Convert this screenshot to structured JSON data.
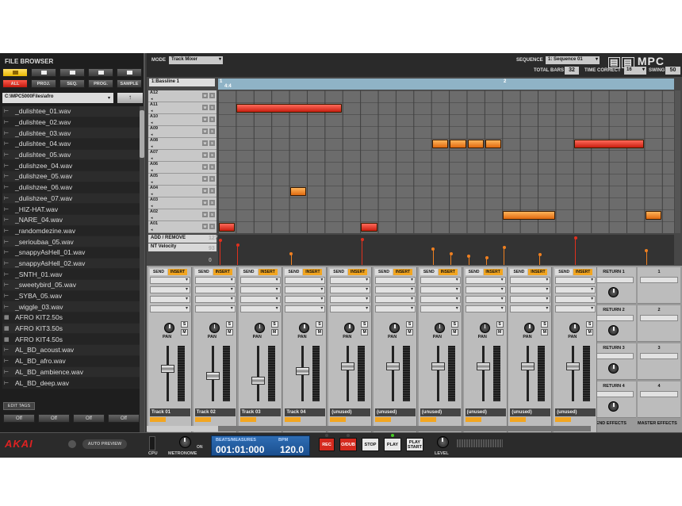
{
  "file_browser": {
    "title": "FILE BROWSER",
    "top_buttons": [
      "",
      "",
      "",
      "",
      ""
    ],
    "type_buttons": [
      "ALL",
      "PROJ.",
      "SEQ.",
      "PROG.",
      "SAMPLE"
    ],
    "path": "C:\\MPC5000Files\\afro",
    "up_label": "↑",
    "files": [
      {
        "name": "_dulishtee_01.wav",
        "icon": "audio"
      },
      {
        "name": "_dulishtee_02.wav",
        "icon": "audio"
      },
      {
        "name": "_dulishtee_03.wav",
        "icon": "audio"
      },
      {
        "name": "_dulishtee_04.wav",
        "icon": "audio"
      },
      {
        "name": "_dulishtee_05.wav",
        "icon": "audio"
      },
      {
        "name": "_dulishzee_04.wav",
        "icon": "audio"
      },
      {
        "name": "_dulishzee_05.wav",
        "icon": "audio"
      },
      {
        "name": "_dulishzee_06.wav",
        "icon": "audio"
      },
      {
        "name": "_dulishzee_07.wav",
        "icon": "audio"
      },
      {
        "name": "_HIZ-HAT.wav",
        "icon": "audio"
      },
      {
        "name": "_NARE_04.wav",
        "icon": "audio"
      },
      {
        "name": "_randomdezine.wav",
        "icon": "audio"
      },
      {
        "name": "_serioubaa_05.wav",
        "icon": "audio"
      },
      {
        "name": "_snappyAsHell_01.wav",
        "icon": "audio"
      },
      {
        "name": "_snappyAsHell_02.wav",
        "icon": "audio"
      },
      {
        "name": "_SNTH_01.wav",
        "icon": "audio"
      },
      {
        "name": "_sweetybird_05.wav",
        "icon": "audio"
      },
      {
        "name": "_SYBA_05.wav",
        "icon": "audio"
      },
      {
        "name": "_wiggle_03.wav",
        "icon": "audio"
      },
      {
        "name": "AFRO KIT2.50s",
        "icon": "kit"
      },
      {
        "name": "AFRO KIT3.50s",
        "icon": "kit"
      },
      {
        "name": "AFRO KIT4.50s",
        "icon": "kit"
      },
      {
        "name": "AL_BD_acoust.wav",
        "icon": "audio"
      },
      {
        "name": "AL_BD_afro.wav",
        "icon": "audio"
      },
      {
        "name": "AL_BD_ambience.wav",
        "icon": "audio"
      },
      {
        "name": "AL_BD_deep.wav",
        "icon": "audio"
      }
    ],
    "edit_tags": "EDIT TAGS",
    "off_buttons": [
      "Off",
      "Off",
      "Off",
      "Off"
    ]
  },
  "topbar": {
    "mode_label": "MODE",
    "mode_value": "Track Mixer",
    "sequence_label": "SEQUENCE",
    "sequence_value": "1: Sequence 01",
    "logo": "MPC",
    "total_bars_label": "TOTAL BARS",
    "total_bars": "32",
    "time_correct_label": "TIME CORRECT",
    "time_correct": "16",
    "swing_label": "SWING",
    "swing": "50"
  },
  "sequencer": {
    "track": "1:Bassline 1",
    "ruler_marks": [
      "1",
      "2"
    ],
    "ruler_sub": "4:4",
    "pads": [
      "A12",
      "A11",
      "A10",
      "A09",
      "A08",
      "A07",
      "A06",
      "A05",
      "A04",
      "A03",
      "A02",
      "A01"
    ],
    "pad_buttons": [
      "M",
      "S"
    ],
    "add_remove": "ADD / REMOVE",
    "velocity_label": "NT Velocity",
    "velocity_scale": [
      "127",
      "93",
      "0"
    ],
    "notes": [
      {
        "row": 1,
        "start": 1,
        "length": 6,
        "color": "red"
      },
      {
        "row": 4,
        "start": 12,
        "length": 1,
        "color": "orange"
      },
      {
        "row": 4,
        "start": 13,
        "length": 1,
        "color": "orange"
      },
      {
        "row": 4,
        "start": 14,
        "length": 1,
        "color": "orange"
      },
      {
        "row": 4,
        "start": 15,
        "length": 1,
        "color": "orange"
      },
      {
        "row": 4,
        "start": 20,
        "length": 4,
        "color": "red"
      },
      {
        "row": 8,
        "start": 4,
        "length": 1,
        "color": "orange"
      },
      {
        "row": 10,
        "start": 16,
        "length": 3,
        "color": "orange"
      },
      {
        "row": 10,
        "start": 24,
        "length": 1,
        "color": "orange"
      },
      {
        "row": 11,
        "start": 0,
        "length": 1,
        "color": "red"
      },
      {
        "row": 11,
        "start": 8,
        "length": 1,
        "color": "red"
      }
    ],
    "velocities": [
      {
        "step": 0,
        "value": 0.85,
        "color": "red"
      },
      {
        "step": 1,
        "value": 0.7,
        "color": "red"
      },
      {
        "step": 4,
        "value": 0.4,
        "color": "orange"
      },
      {
        "step": 8,
        "value": 0.9,
        "color": "red"
      },
      {
        "step": 12,
        "value": 0.55,
        "color": "orange"
      },
      {
        "step": 13,
        "value": 0.4,
        "color": "orange"
      },
      {
        "step": 14,
        "value": 0.3,
        "color": "orange"
      },
      {
        "step": 15,
        "value": 0.25,
        "color": "orange"
      },
      {
        "step": 16,
        "value": 0.6,
        "color": "orange"
      },
      {
        "step": 18,
        "value": 0.35,
        "color": "orange"
      },
      {
        "step": 20,
        "value": 0.95,
        "color": "red"
      },
      {
        "step": 24,
        "value": 0.5,
        "color": "orange"
      }
    ],
    "colors": {
      "red": "#e0301e",
      "orange": "#f08020"
    }
  },
  "mixer": {
    "send_label": "SEND",
    "insert_label": "INSERT",
    "pan_label": "PAN",
    "solo_label": "S",
    "mute_label": "M",
    "tracks": [
      {
        "name": "Track 01",
        "fader": 0.6
      },
      {
        "name": "Track 02",
        "fader": 0.45
      },
      {
        "name": "Track 03",
        "fader": 0.35
      },
      {
        "name": "Track 04",
        "fader": 0.55
      },
      {
        "name": "(unused)",
        "fader": 0.65
      },
      {
        "name": "(unused)",
        "fader": 0.65
      },
      {
        "name": "(unused)",
        "fader": 0.65
      },
      {
        "name": "(unused)",
        "fader": 0.65
      },
      {
        "name": "(unused)",
        "fader": 0.65
      },
      {
        "name": "(unused)",
        "fader": 0.65
      }
    ],
    "returns": [
      "RETURN 1",
      "RETURN 2",
      "RETURN 3",
      "RETURN 4"
    ],
    "masters": [
      "1",
      "2",
      "3",
      "4"
    ],
    "send_effects": "SEND EFFECTS",
    "master_effects": "MASTER EFFECTS"
  },
  "transport": {
    "brand": "AKAI",
    "auto_preview": "AUTO PREVIEW",
    "cpu_label": "CPU",
    "metronome_label": "METRONOME",
    "on_label": "ON",
    "beats_label": "BEATS/MEASURES",
    "bpm_label": "BPM",
    "position": "001:01:000",
    "bpm": "120.0",
    "rec": "REC",
    "odub": "O/DUB",
    "stop": "STOP",
    "play": "PLAY",
    "play_start": "PLAY START",
    "level_label": "LEVEL"
  }
}
